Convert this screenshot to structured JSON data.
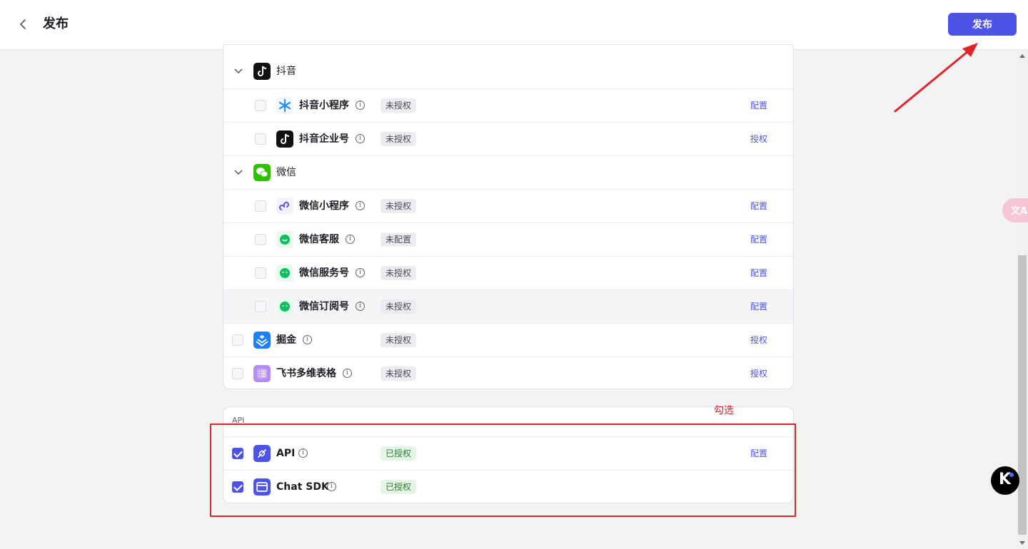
{
  "header": {
    "title": "发布",
    "publish_label": "发布"
  },
  "groups": [
    {
      "name": "抖音",
      "icon": "douyin-icon"
    },
    {
      "name": "微信",
      "icon": "wechat-icon"
    }
  ],
  "rows": [
    {
      "label": "抖音小程序",
      "status": "未授权",
      "action": "配置",
      "icon": "douyin-miniapp-icon"
    },
    {
      "label": "抖音企业号",
      "status": "未授权",
      "action": "授权",
      "icon": "douyin-enterprise-icon"
    },
    {
      "label": "微信小程序",
      "status": "未授权",
      "action": "配置",
      "icon": "wechat-miniapp-icon"
    },
    {
      "label": "微信客服",
      "status": "未配置",
      "action": "配置",
      "icon": "wechat-service-icon"
    },
    {
      "label": "微信服务号",
      "status": "未授权",
      "action": "配置",
      "icon": "wechat-official-icon"
    },
    {
      "label": "微信订阅号",
      "status": "未授权",
      "action": "配置",
      "icon": "wechat-subscription-icon"
    },
    {
      "label": "掘金",
      "status": "未授权",
      "action": "授权",
      "icon": "juejin-icon"
    },
    {
      "label": "飞书多维表格",
      "status": "未授权",
      "action": "授权",
      "icon": "feishu-bitable-icon"
    }
  ],
  "api_section": {
    "title": "API",
    "rows": [
      {
        "label": "API",
        "status": "已授权",
        "action": "配置",
        "checked": true,
        "icon": "api-icon"
      },
      {
        "label": "Chat SDK",
        "status": "已授权",
        "action": "",
        "checked": true,
        "icon": "chat-sdk-icon"
      }
    ]
  },
  "annotation": {
    "text": "勾选",
    "color": "#e0242a"
  },
  "colors": {
    "accent": "#4d53e8",
    "authorized": "#2e7d32"
  },
  "floating": {
    "translate_label": "文A",
    "k_label": "K"
  }
}
